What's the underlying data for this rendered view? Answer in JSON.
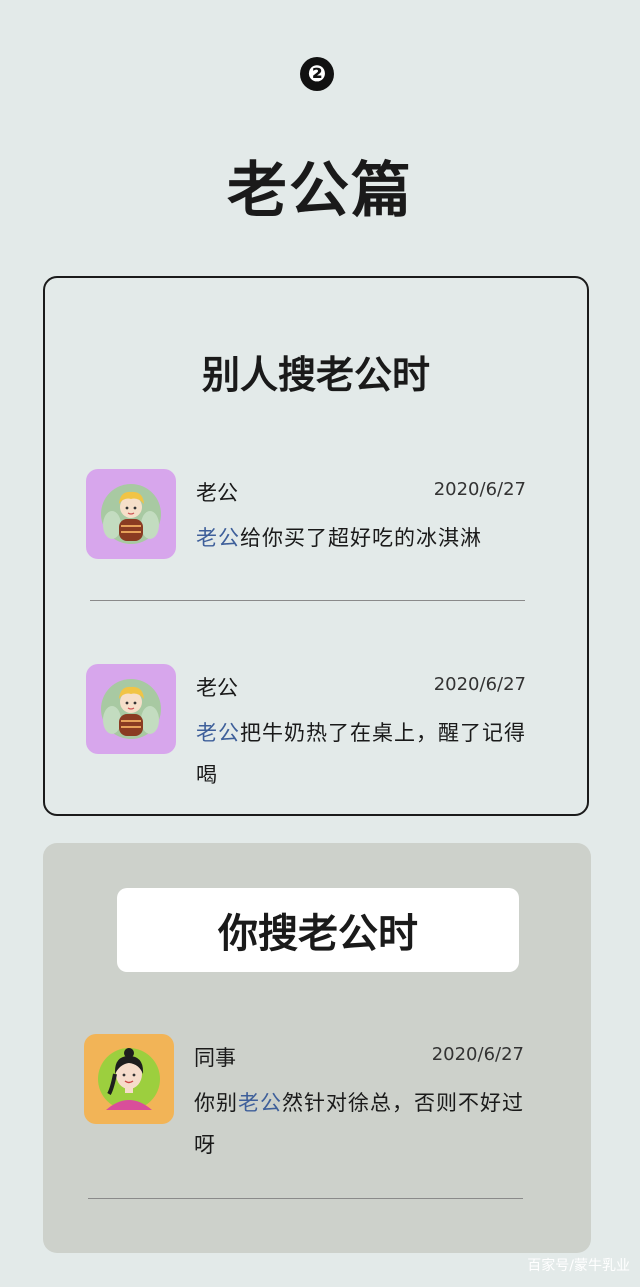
{
  "step_number": "❷",
  "page_title": "老公篇",
  "section1": {
    "title": "别人搜老公时",
    "messages": [
      {
        "sender": "老公",
        "date": "2020/6/27",
        "highlight": "老公",
        "text": "给你买了超好吃的冰淇淋",
        "avatar_bg": "#d7a6ec",
        "avatar_icon": "boy-avatar-icon"
      },
      {
        "sender": "老公",
        "date": "2020/6/27",
        "highlight": "老公",
        "text": "把牛奶热了在桌上，醒了记得喝",
        "avatar_bg": "#d7a6ec",
        "avatar_icon": "boy-avatar-icon"
      }
    ]
  },
  "section2": {
    "title": "你搜老公时",
    "messages": [
      {
        "sender": "同事",
        "date": "2020/6/27",
        "prefix": "你别",
        "highlight": "老公",
        "text": "然针对徐总，否则不好过呀",
        "avatar_bg": "#f2b457",
        "avatar_icon": "girl-avatar-icon"
      }
    ]
  },
  "watermark": "百家号/蒙牛乳业",
  "colors": {
    "background": "#e3eae9",
    "highlight": "#3e5f9a",
    "card2_bg": "#cdd1cb"
  }
}
